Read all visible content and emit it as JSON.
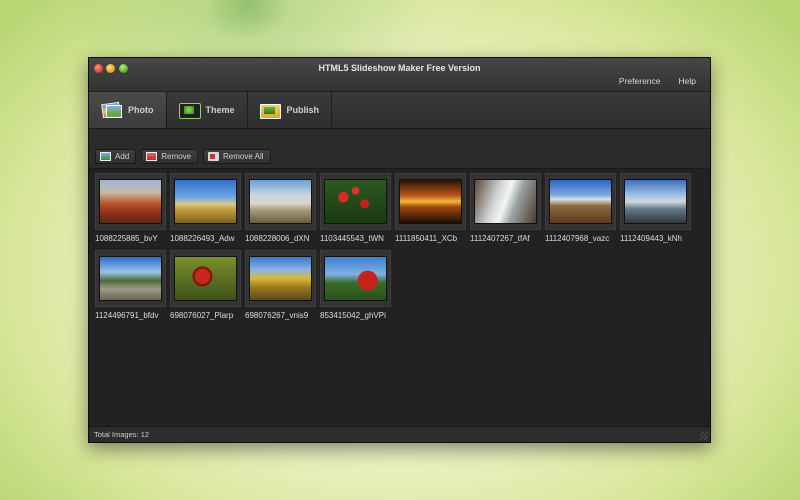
{
  "window": {
    "title": "HTML5 Slideshow Maker Free Version"
  },
  "menu": [
    {
      "label": "Preference"
    },
    {
      "label": "Help"
    }
  ],
  "toolbar": {
    "tabs": [
      {
        "label": "Photo",
        "icon": "photo-icon"
      },
      {
        "label": "Theme",
        "icon": "theme-icon"
      },
      {
        "label": "Publish",
        "icon": "publish-icon"
      }
    ]
  },
  "actions": {
    "add_label": "Add",
    "remove_label": "Remove",
    "remove_all_label": "Remove All"
  },
  "images": [
    {
      "caption": "1088225885_bvY"
    },
    {
      "caption": "1088226493_Adw"
    },
    {
      "caption": "1088228006_dXN"
    },
    {
      "caption": "1103445543_tWN"
    },
    {
      "caption": "1111850411_XCb"
    },
    {
      "caption": "1112407267_tfAf"
    },
    {
      "caption": "1112407968_vazc"
    },
    {
      "caption": "1112409443_kNh"
    },
    {
      "caption": "1124496791_bfdv"
    },
    {
      "caption": "698076027_Plarp"
    },
    {
      "caption": "698076267_vnis9"
    },
    {
      "caption": "853415042_ghVPi"
    }
  ],
  "status": {
    "text": "Total Images: 12"
  }
}
